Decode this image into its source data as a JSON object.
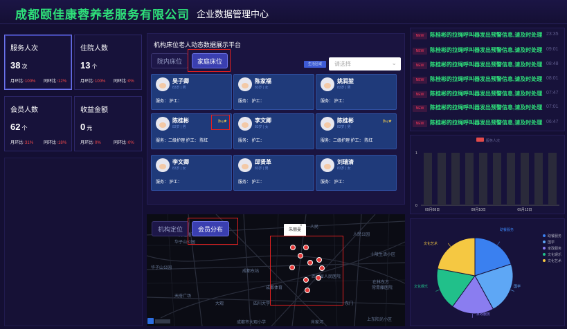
{
  "header": {
    "company": "成都颐佳康蓉养老服务有限公司",
    "subtitle": "企业数据管理中心"
  },
  "stats": [
    {
      "title": "服务人次",
      "value": "38",
      "unit": "次",
      "mom_label": "月环比",
      "mom": "↑100%",
      "yoy_label": "同环比",
      "yoy": "↑12%"
    },
    {
      "title": "住院人数",
      "value": "13",
      "unit": "个",
      "mom_label": "月环比",
      "mom": "↑100%",
      "yoy_label": "同环比",
      "yoy": "↑0%"
    },
    {
      "title": "会员人数",
      "value": "62",
      "unit": "个",
      "mom_label": "月环比",
      "mom": "↑31%",
      "yoy_label": "同环比",
      "yoy": "↑18%"
    },
    {
      "title": "收益金额",
      "value": "0",
      "unit": "元",
      "mom_label": "月环比",
      "mom": "↑0%",
      "yoy_label": "同环比",
      "yoy": "↑0%"
    }
  ],
  "beds_panel": {
    "title": "机构床位老人动态数据展示平台",
    "tab_inst": "院内床位",
    "tab_home": "家庭床位",
    "filter_label": "生活区域",
    "select_placeholder": "请选择"
  },
  "beds": [
    {
      "name": "吴子卿",
      "info": "83岁 | 男",
      "service": "服务：    护工：",
      "icon": ""
    },
    {
      "name": "陈家福",
      "info": "83岁 | 女",
      "service": "服务：    护工：",
      "icon": ""
    },
    {
      "name": "姚润堃",
      "info": "83岁 | 男",
      "service": "服务：    护工：",
      "icon": ""
    },
    {
      "name": "陈桂彬",
      "info": "83岁 | 男",
      "service": "服务：二级护理  护工：     陈红",
      "icon": "🛏★"
    },
    {
      "name": "李文卿",
      "info": "83岁 | 女",
      "service": "服务：    护工：",
      "icon": ""
    },
    {
      "name": "陈桂彬",
      "info": "83岁 | 男",
      "service": "服务：二级护理  护工：     陈红",
      "icon": "🛏★"
    },
    {
      "name": "李文卿",
      "info": "83岁 | 女",
      "service": "服务：    护工：",
      "icon": ""
    },
    {
      "name": "邱贤革",
      "info": "83岁 | 男",
      "service": "服务：    护工：",
      "icon": ""
    },
    {
      "name": "刘瑞清",
      "info": "83岁 | 女",
      "service": "服务：    护工：",
      "icon": ""
    }
  ],
  "map": {
    "tab_inst": "机构定位",
    "tab_members": "会员分布",
    "popup": "朱丽曼",
    "labels": [
      "人民北路",
      "人民",
      "华子山公园",
      "华子山公园",
      "成都东站",
      "西川省人民医院",
      "天府广场",
      "大观",
      "四川大学",
      "成都市大观小学",
      "肖家河",
      "上东阳光小区",
      "十陵生活小区",
      "在林东方",
      "常青藤医院",
      "人民公园",
      "成都体育",
      "东门"
    ]
  },
  "alerts": [
    {
      "tag": "NEW",
      "text": "陈桂彬的拉绳呼叫器发出预警信息,请及时处理",
      "time": "23:35"
    },
    {
      "tag": "NEW",
      "text": "陈桂彬的拉绳呼叫器发出预警信息,请及时处理",
      "time": "09:01"
    },
    {
      "tag": "NEW",
      "text": "陈桂彬的拉绳呼叫器发出预警信息,请及时处理",
      "time": "08:48"
    },
    {
      "tag": "NEW",
      "text": "陈桂彬的拉绳呼叫器发出预警信息,请及时处理",
      "time": "08:01"
    },
    {
      "tag": "NEW",
      "text": "陈桂彬的拉绳呼叫器发出预警信息,请及时处理",
      "time": "07:47"
    },
    {
      "tag": "NEW",
      "text": "陈桂彬的拉绳呼叫器发出预警信息,请及时处理",
      "time": "07:01"
    },
    {
      "tag": "NEW",
      "text": "陈桂彬的拉绳呼叫器发出预警信息,请及时处理",
      "time": "06:47"
    }
  ],
  "chart_data": [
    {
      "type": "bar",
      "title": "",
      "legend": "服务人次",
      "ylim": [
        0,
        1
      ],
      "yticks": [
        "1",
        "0"
      ],
      "categories": [
        "09月08日",
        "",
        "09月10日",
        "",
        "09月12日",
        ""
      ],
      "bars": 10,
      "color": "#2a2a3a",
      "values": [
        1,
        1,
        1,
        1,
        1,
        1,
        1,
        1,
        1,
        1
      ]
    },
    {
      "type": "pie",
      "labels": [
        "助餐服务",
        "国学",
        "家政服务",
        "文化娱乐",
        "文化艺术"
      ],
      "values": [
        20,
        22,
        18,
        18,
        22
      ],
      "colors": [
        "#3a80f0",
        "#5ea7f5",
        "#8a7df0",
        "#21c08a",
        "#f5c842"
      ]
    }
  ]
}
